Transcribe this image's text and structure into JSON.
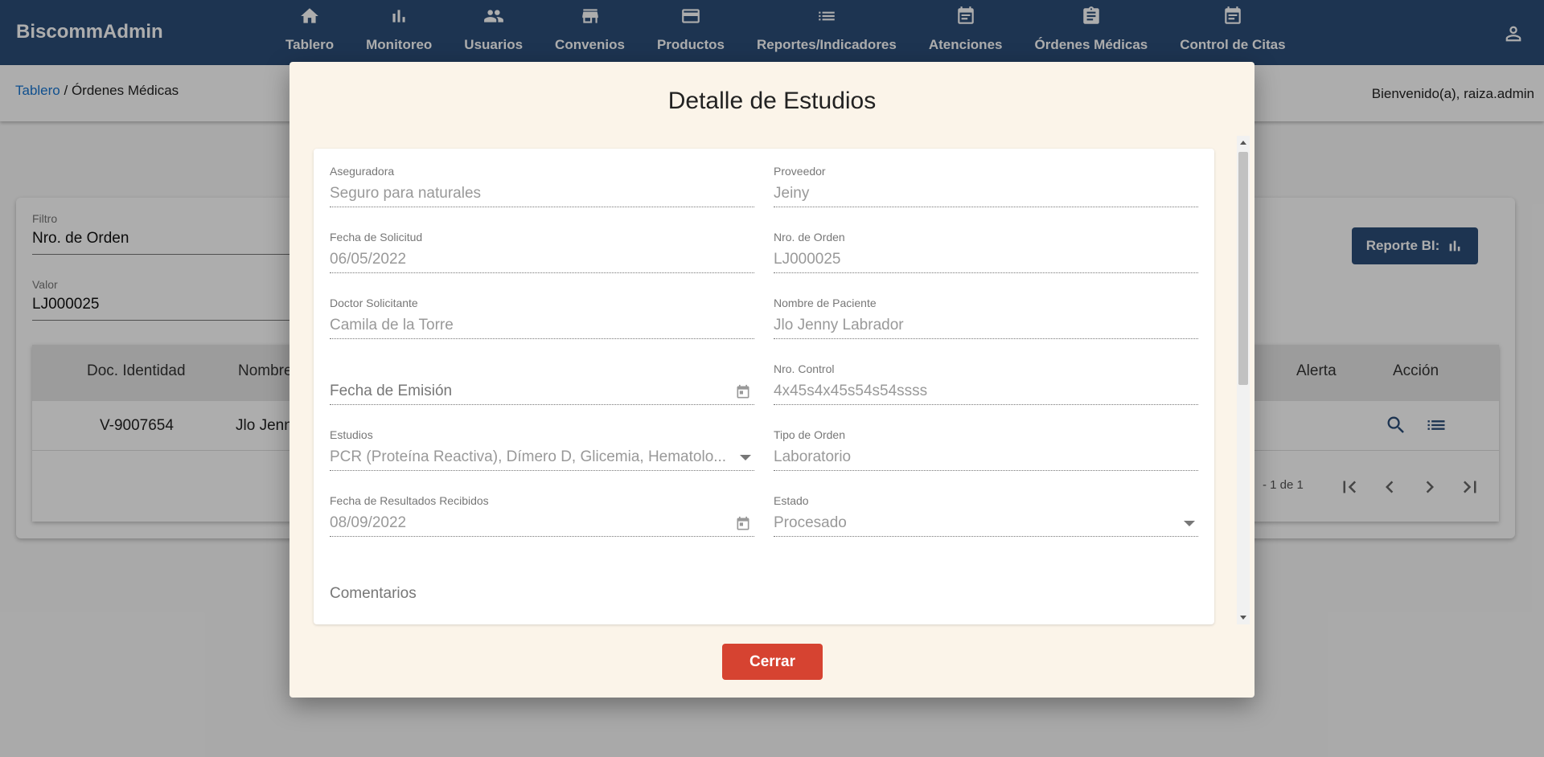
{
  "app": {
    "brand": "BiscommAdmin"
  },
  "nav": [
    {
      "label": "Tablero",
      "icon": "home-icon"
    },
    {
      "label": "Monitoreo",
      "icon": "bar-chart-icon"
    },
    {
      "label": "Usuarios",
      "icon": "people-icon"
    },
    {
      "label": "Convenios",
      "icon": "store-icon"
    },
    {
      "label": "Productos",
      "icon": "credit-card-icon"
    },
    {
      "label": "Reportes/Indicadores",
      "icon": "list-icon"
    },
    {
      "label": "Atenciones",
      "icon": "event-note-icon"
    },
    {
      "label": "Órdenes Médicas",
      "icon": "clipboard-icon"
    },
    {
      "label": "Control de Citas",
      "icon": "event-note-icon"
    }
  ],
  "breadcrumb": {
    "root": "Tablero",
    "separator": " / ",
    "current": "Órdenes Médicas"
  },
  "welcome": "Bienvenido(a), raiza.admin",
  "filter": {
    "filter_label": "Filtro",
    "filter_value": "Nro. de Orden",
    "value_label": "Valor",
    "value_value": "LJ000025"
  },
  "report_button": {
    "label": "Reporte BI:",
    "icon": "bar-chart-icon"
  },
  "table": {
    "headers": {
      "doc": "Doc. Identidad",
      "name": "Nombre",
      "alert": "Alerta",
      "action": "Acción"
    },
    "row": {
      "doc": "V-9007654",
      "name": "Jlo Jenny Labrador"
    },
    "row_actions": [
      "search-icon",
      "list-icon"
    ],
    "range": "- 1 de 1"
  },
  "dialog": {
    "title": "Detalle de Estudios",
    "fields": {
      "aseguradora": {
        "label": "Aseguradora",
        "value": "Seguro para naturales"
      },
      "proveedor": {
        "label": "Proveedor",
        "value": "Jeiny"
      },
      "fecha_solicitud": {
        "label": "Fecha de Solicitud",
        "value": "06/05/2022"
      },
      "nro_orden": {
        "label": "Nro. de Orden",
        "value": "LJ000025"
      },
      "doctor": {
        "label": "Doctor Solicitante",
        "value": "Camila de la Torre"
      },
      "paciente": {
        "label": "Nombre de Paciente",
        "value": "Jlo Jenny Labrador"
      },
      "fecha_emision": {
        "label": "",
        "value": "Fecha de Emisión"
      },
      "nro_control": {
        "label": "Nro. Control",
        "value": "4x45s4x45s54s54ssss"
      },
      "estudios": {
        "label": "Estudios",
        "value": "PCR (Proteína Reactiva), Dímero D, Glicemia, Hematolo..."
      },
      "tipo_orden": {
        "label": "Tipo de Orden",
        "value": "Laboratorio"
      },
      "fecha_resultados": {
        "label": "Fecha de Resultados Recibidos",
        "value": "08/09/2022"
      },
      "estado": {
        "label": "Estado",
        "value": "Procesado"
      }
    },
    "comments_label": "Comentarios",
    "close_label": "Cerrar"
  },
  "colors": {
    "topbar": "#2b4d78",
    "dialog_bg": "#fbf4e9",
    "close_button": "#d64331",
    "link": "#1976d2"
  }
}
